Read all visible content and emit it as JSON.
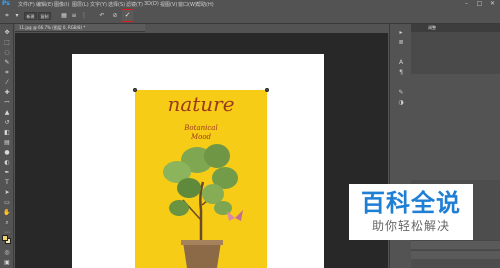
{
  "app": {
    "logo": "Ps"
  },
  "menu": {
    "items": [
      "文件(F)",
      "编辑(E)",
      "图像(I)",
      "图层(L)",
      "文字(Y)",
      "选择(S)",
      "滤镜(T)",
      "3D(D)",
      "视图(V)",
      "窗口(W)",
      "帮助(H)"
    ],
    "window_buttons": [
      "–",
      "□",
      "✕"
    ]
  },
  "options_bar": {
    "buttons": [
      "新建",
      "复制"
    ],
    "commit_symbol": "✓",
    "cancel_symbol": "⊘",
    "undo_symbol": "↶"
  },
  "document_tab": {
    "label": "11.jpg @ 66.7% (图层 0, RGB/8) *"
  },
  "poster": {
    "title": "nature",
    "subtitle_line1": "Botanical",
    "subtitle_line2": "Mood"
  },
  "panel": {
    "tab_label": "调整"
  },
  "watermark": {
    "title": "百科全说",
    "subtitle": "助你轻松解决"
  },
  "colors": {
    "accent_red": "#e0191f",
    "poster_yellow": "#f7cc16",
    "brand_blue": "#1f7fd4"
  }
}
